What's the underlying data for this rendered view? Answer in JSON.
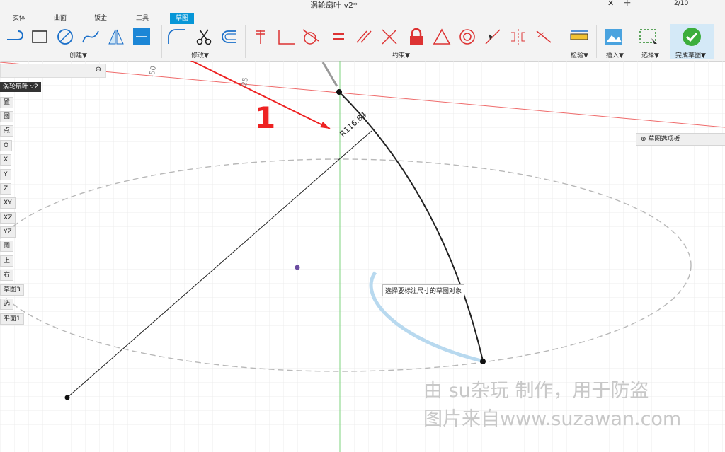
{
  "window": {
    "title": "涡轮扇叶 v2*",
    "version_badge": "2/10"
  },
  "tabs": [
    {
      "label": "实体"
    },
    {
      "label": "曲面"
    },
    {
      "label": "钣金"
    },
    {
      "label": "工具"
    },
    {
      "label": "草图",
      "active": true
    }
  ],
  "groups": {
    "create": "创建▼",
    "modify": "修改▼",
    "constraints": "约束▼",
    "inspect": "检验▼",
    "insert": "插入▼",
    "select": "选择▼",
    "finish": "完成草图▼"
  },
  "browser": {
    "title": "涡轮扇叶 v2",
    "nodes": [
      "置",
      "图",
      "点",
      "O",
      "X",
      "Y",
      "Z",
      "XY",
      "XZ",
      "YZ",
      "图",
      "上",
      "右",
      "草图3",
      "选",
      "平面1"
    ]
  },
  "axis_labels": [
    "-50",
    "-25"
  ],
  "dimension": {
    "text": "R116.84"
  },
  "annotation": {
    "number": "1"
  },
  "tooltip": {
    "text": "选择要标注尺寸的草图对象"
  },
  "palette": {
    "label": "草图选项板"
  },
  "watermark": {
    "line1": "由 su杂玩 制作，用于防盗",
    "line2": "图片来自www.suzawan.com"
  },
  "colors": {
    "accent": "#0696d7",
    "red_axis": "#ef6b6b",
    "green_axis": "#7ed37e",
    "annot": "#e02020"
  },
  "icons": {
    "finish": "check-circle-icon",
    "trim": "scissors-icon",
    "lock": "lock-icon"
  }
}
